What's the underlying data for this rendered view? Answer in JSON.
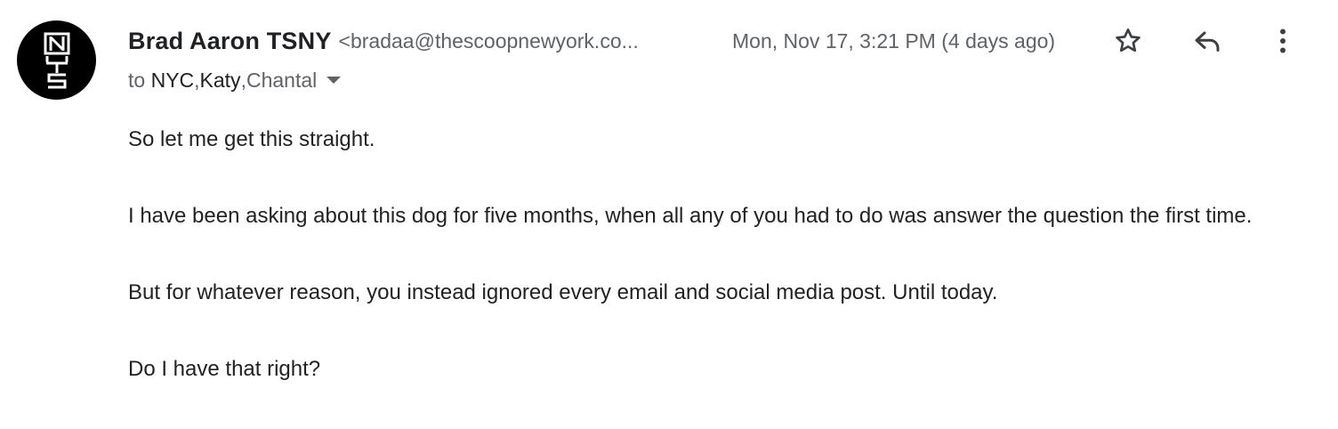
{
  "sender": {
    "name": "Brad Aaron TSNY",
    "email": "<bradaa@thescoopnewyork.co...",
    "avatar_icon": "tsny-logo-icon"
  },
  "date": "Mon, Nov 17, 3:21 PM (4 days ago)",
  "actions": {
    "star_icon": "star-icon",
    "reply_icon": "reply-icon",
    "more_icon": "more-vert-icon"
  },
  "recipients": {
    "prefix": "to ",
    "r1": "NYC",
    "sep1": ", ",
    "r2": "Katy",
    "sep2": ", ",
    "r3": "Chantal",
    "dropdown_icon": "caret-down-icon"
  },
  "body": {
    "p1": "So let me get this straight.",
    "p2": "I have been asking about this dog for five months, when all any of you had to do was answer the question the first time.",
    "p3": "But for whatever reason, you instead ignored every email and social media post. Until today.",
    "p4": "Do I have that right?"
  },
  "colors": {
    "primary_text": "#202124",
    "secondary_text": "#5f6368",
    "avatar_bg": "#000000"
  }
}
